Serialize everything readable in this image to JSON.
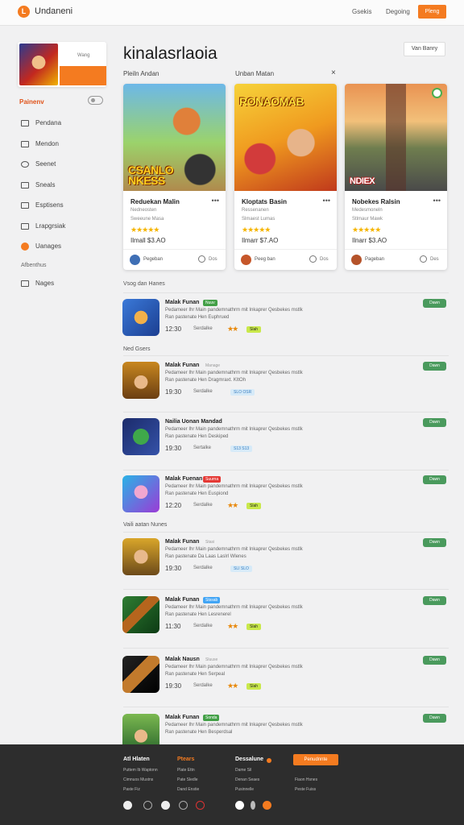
{
  "header": {
    "brand_letter": "L",
    "app_title": "Undaneni",
    "nav": [
      "Gsekis",
      "Degoing"
    ],
    "cta": "Pleng"
  },
  "sidebar": {
    "profile_name": "Wang",
    "filter_label": "Painenv",
    "items": [
      {
        "label": "Pendana",
        "icon": "folder-icon"
      },
      {
        "label": "Mendon",
        "icon": "inbox-icon"
      },
      {
        "label": "Seenet",
        "icon": "settings-icon"
      },
      {
        "label": "Sneals",
        "icon": "doc-icon"
      },
      {
        "label": "Esptisens",
        "icon": "tag-icon"
      },
      {
        "label": "Lrapgrsiak",
        "icon": "book-icon"
      },
      {
        "label": "Uanages",
        "icon": "user-icon"
      }
    ],
    "subheading": "Afbenthus",
    "last_item": {
      "label": "Nages",
      "icon": "list-icon"
    }
  },
  "main": {
    "title": "kinalasrlaoia",
    "action_button": "Van Banry",
    "tabs": [
      "Pleiln Andan",
      "Unban Matan"
    ],
    "close_symbol": "×"
  },
  "cards": [
    {
      "art_text": "CSANLO\nNKESS",
      "title": "Reduekan Malin",
      "sub1": "Nedneosten",
      "sub2": "Sweeune Masa",
      "stars": "★★★★★",
      "price": "Ilmall  $3.AO",
      "author": "Pegeban",
      "count": "Dos",
      "accent": "#d9822b"
    },
    {
      "art_text": "RONAOMAB",
      "title": "Kloptats Basin",
      "sub1": "Ressenanen",
      "sub2": "Slmaest Lumas",
      "stars": "★★★★★",
      "price": "Ilmarr  $7.AO",
      "author": "Peeg ban",
      "count": "Dos",
      "accent": "#c0392b"
    },
    {
      "art_text": "NDIEX",
      "title": "Nobekes Ralsin",
      "sub1": "Medesmoneln",
      "sub2": "Stlmaur Mawk",
      "stars": "★★★★★",
      "price": "Ilnarr  $3.AO",
      "author": "Pageban",
      "count": "Des",
      "accent": "#5a3f8a"
    }
  ],
  "sections": [
    "Vsog dan Hanes",
    "Ned Gsers",
    "Vaili aatan Nunes"
  ],
  "list": [
    {
      "title": "Malak Funan",
      "tag": "Nuuv",
      "tag_color": "#43a047",
      "desc1": "Pedameer Ihr Main pandemnathrm mit Inkaprer Qesbekes mstlk",
      "desc2": "Ran pastenate Hen Euphrued",
      "time": "12:30",
      "meta": "Serdalke",
      "stars": "★★",
      "badge": "Slah",
      "badge_color": "#c9e84b",
      "btn": "Dawn"
    },
    {
      "title": "Malak Funan",
      "tag": "Manage",
      "tag_color": "#bbbbbb",
      "desc1": "Pedameer Ihr Main pandemnathrm mit Inkaprer Qesbekes mstlk",
      "desc2": "Ran pastenate Hen Dragmraxt. KItOh",
      "time": "19:30",
      "meta": "Serdalke",
      "stars": "",
      "badge": "SLO  OSR",
      "badge_color": "#d6eaf8",
      "btn": "Dawn"
    },
    {
      "title": "Nailia Uonan Mandad",
      "tag": "",
      "tag_color": "",
      "desc1": "Pedameer Ihr Main pandemnathrm mit Inkaprer Qesbekes mstlk",
      "desc2": "Ran pastenate Hen Deskiped",
      "time": "19:30",
      "meta": "Sertalke",
      "stars": "",
      "badge": "S13  S13",
      "badge_color": "#d6eaf8",
      "btn": "Dawn"
    },
    {
      "title": "Malak Fuenan",
      "tag": "Suurna",
      "tag_color": "#e53935",
      "desc1": "Pedameer Ihr Main pandemnathrm mit Inkaprer Qesbekes mstlk",
      "desc2": "Ran pastenate Hen Euspiond",
      "time": "12:20",
      "meta": "Serdalke",
      "stars": "★★",
      "badge": "Slah",
      "badge_color": "#c9e84b",
      "btn": "Dawn"
    },
    {
      "title": "Malak Funan",
      "tag": "Stasi",
      "tag_color": "#bbbbbb",
      "desc1": "Pedameer Ihr Main pandemnathrm mit Inkaprer Qesbekes mstlk",
      "desc2": "Ran pastenate Da  Laas Laslrl Wlenes",
      "time": "19:30",
      "meta": "Serdalke",
      "stars": "",
      "badge": "SLI  SLO",
      "badge_color": "#d6eaf8",
      "btn": "Dawn"
    },
    {
      "title": "Malak Funan",
      "tag": "Stssab",
      "tag_color": "#42a5f5",
      "desc1": "Pedameer Ihr Main pandemnathrm mit Inkaprer Qesbekes mstlk",
      "desc2": "Ran pastenate Hen Lesrenerel",
      "time": "11:30",
      "meta": "Serdalke",
      "stars": "★★",
      "badge": "Slah",
      "badge_color": "#c9e84b",
      "btn": "Dawn"
    },
    {
      "title": "Malak Nausn",
      "tag": "Sluuse",
      "tag_color": "#bbbbbb",
      "desc1": "Pedameer Ihr Main pandemnathrm mit Inkaprer Qesbekes mstlk",
      "desc2": "Ran pastenate Hen Serpeal",
      "time": "19:30",
      "meta": "Serdalke",
      "stars": "★★",
      "badge": "Slah",
      "badge_color": "#c9e84b",
      "btn": "Dawn"
    },
    {
      "title": "Malak Funan",
      "tag": "Sonda",
      "tag_color": "#43a047",
      "desc1": "Pedameer Ihr Main pandemnathrm mit Inkaprer Qesbekes mstlk",
      "desc2": "Ran pastenate Hen Besperdsal",
      "time": "",
      "meta": "",
      "stars": "",
      "badge": "",
      "badge_color": "",
      "btn": "Dawn"
    }
  ],
  "footer": {
    "col1_head": "Atl Hlaten",
    "col1_links": [
      "Puttem Ib Waptonn",
      "Cimnuos Mustns",
      "Paste Fiz"
    ],
    "col2_head": "Ptears",
    "col2_links": [
      "Plate Ettn",
      "Pate Sledle",
      "Dand Enstie"
    ],
    "col3_head": "Dessalune",
    "col3_links": [
      "Dame Sil",
      "Denan Seaes",
      "Pusinnelle"
    ],
    "button": "Penudnnte",
    "col4_links": [
      "Fiaon Hsnes",
      "Peste Fuiss"
    ]
  }
}
